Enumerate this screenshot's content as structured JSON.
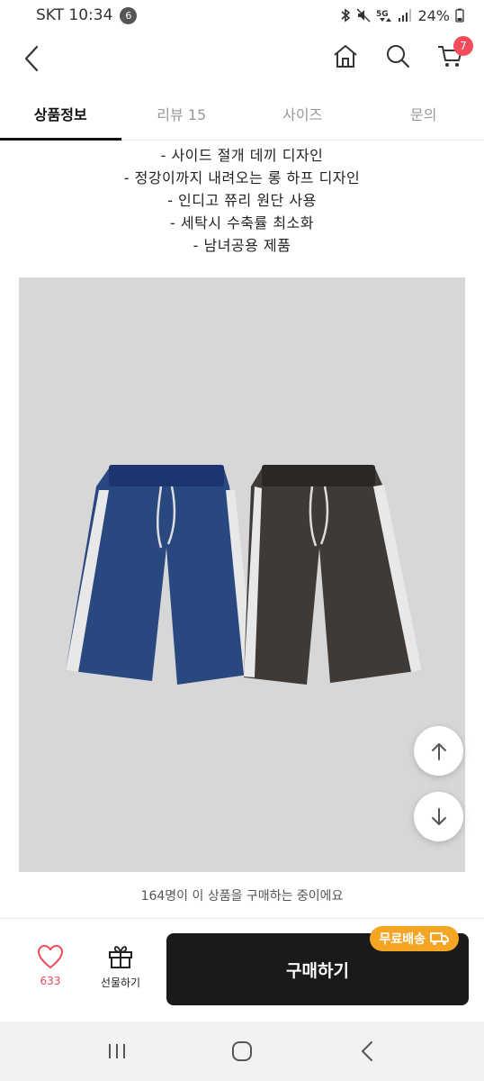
{
  "status_bar": {
    "carrier_time": "SKT 10:34",
    "notification_count": "6",
    "battery": "24%",
    "icons": [
      "bluetooth-icon",
      "mute-icon",
      "5g-icon",
      "signal-icon",
      "battery-icon"
    ]
  },
  "header": {
    "back_icon": "chevron-left-icon",
    "home_icon": "home-icon",
    "search_icon": "search-icon",
    "cart_icon": "cart-icon",
    "cart_count": "7"
  },
  "tabs": [
    {
      "label": "상품정보",
      "active": true
    },
    {
      "label": "리뷰 15",
      "active": false
    },
    {
      "label": "사이즈",
      "active": false
    },
    {
      "label": "문의",
      "active": false
    }
  ],
  "description": {
    "lines": [
      "- 사이드 절개 데끼 디자인",
      "- 정강이까지 내려오는 롱 하프 디자인",
      "- 인디고 쮸리 원단 사용",
      "- 세탁시 수축률 최소화",
      "- 남녀공용 제품"
    ]
  },
  "product_image": {
    "subject": "navy and charcoal long half shorts with white side stripes",
    "colors": {
      "navy": "#2a4880",
      "charcoal": "#3f3a36",
      "stripe": "#e8e8e8",
      "background": "#d7d7d7"
    }
  },
  "notice": {
    "text": "164명이 이 상품을 구매하는 중이에요"
  },
  "purchase_bar": {
    "like_count": "633",
    "gift_label": "선물하기",
    "buy_label": "구매하기",
    "shipping_badge": "무료배송"
  },
  "colors": {
    "accent_red": "#f24b5a",
    "badge_orange": "#f5a524",
    "button_dark": "#1a1a1a"
  }
}
